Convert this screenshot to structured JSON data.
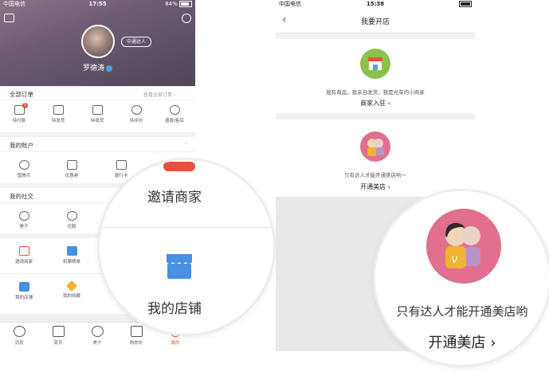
{
  "left": {
    "status": {
      "carrier": "中国电信",
      "time": "17:55",
      "battery": "84%"
    },
    "profile": {
      "badge": "中通达人",
      "name": "罗德涛"
    },
    "orders": {
      "title": "全部订单",
      "link": "查看全部订单",
      "items": [
        {
          "label": "待付款",
          "badge": "1",
          "icon": "wallet-icon"
        },
        {
          "label": "待发货",
          "icon": "box-icon"
        },
        {
          "label": "待收货",
          "icon": "truck-icon"
        },
        {
          "label": "待评价",
          "icon": "comment-icon"
        },
        {
          "label": "退款/售后",
          "icon": "refund-icon"
        }
      ]
    },
    "account": {
      "title": "我的账户",
      "items": [
        {
          "label": "国美币",
          "icon": "coin-icon"
        },
        {
          "label": "优惠券",
          "icon": "coupon-icon"
        },
        {
          "label": "银行卡",
          "icon": "card-icon"
        }
      ]
    },
    "social": {
      "title": "我的社交",
      "items": [
        {
          "label": "美子",
          "icon": "planet-icon"
        },
        {
          "label": "优聊",
          "icon": "chat-icon"
        }
      ]
    },
    "tools": {
      "items": [
        {
          "label": "邀请商家",
          "icon": "invite-icon"
        },
        {
          "label": "机票晒单",
          "icon": "ticket-icon"
        },
        {
          "label": "我的店铺",
          "icon": "store-icon"
        },
        {
          "label": "我的收藏",
          "icon": "star-icon"
        }
      ]
    },
    "tabs": [
      {
        "label": "消息",
        "icon": "message-icon"
      },
      {
        "label": "首页",
        "icon": "home-icon"
      },
      {
        "label": "美子",
        "icon": "planet-icon"
      },
      {
        "label": "购物车",
        "icon": "cart-icon"
      },
      {
        "label": "我的",
        "icon": "user-icon",
        "active": true
      }
    ],
    "lens": {
      "top_text": "邀请商家",
      "bottom_text": "我的店铺"
    }
  },
  "right": {
    "status": {
      "carrier": "中国电信",
      "time": "15:38"
    },
    "nav": {
      "title": "我要开店"
    },
    "merchant": {
      "desc": "我有商品，我亲自发货，我是光荣的小商家",
      "link": "商家入驻"
    },
    "talent": {
      "desc": "只有达人才能开通美店哟～",
      "link": "开通美店"
    },
    "lens": {
      "desc": "只有达人才能开通美店哟",
      "link": "开通美店"
    }
  },
  "colors": {
    "accent": "#e8503a",
    "store_blue": "#4a90e2",
    "merchant_green": "#8bc34a",
    "talent_pink": "#e0708e"
  }
}
